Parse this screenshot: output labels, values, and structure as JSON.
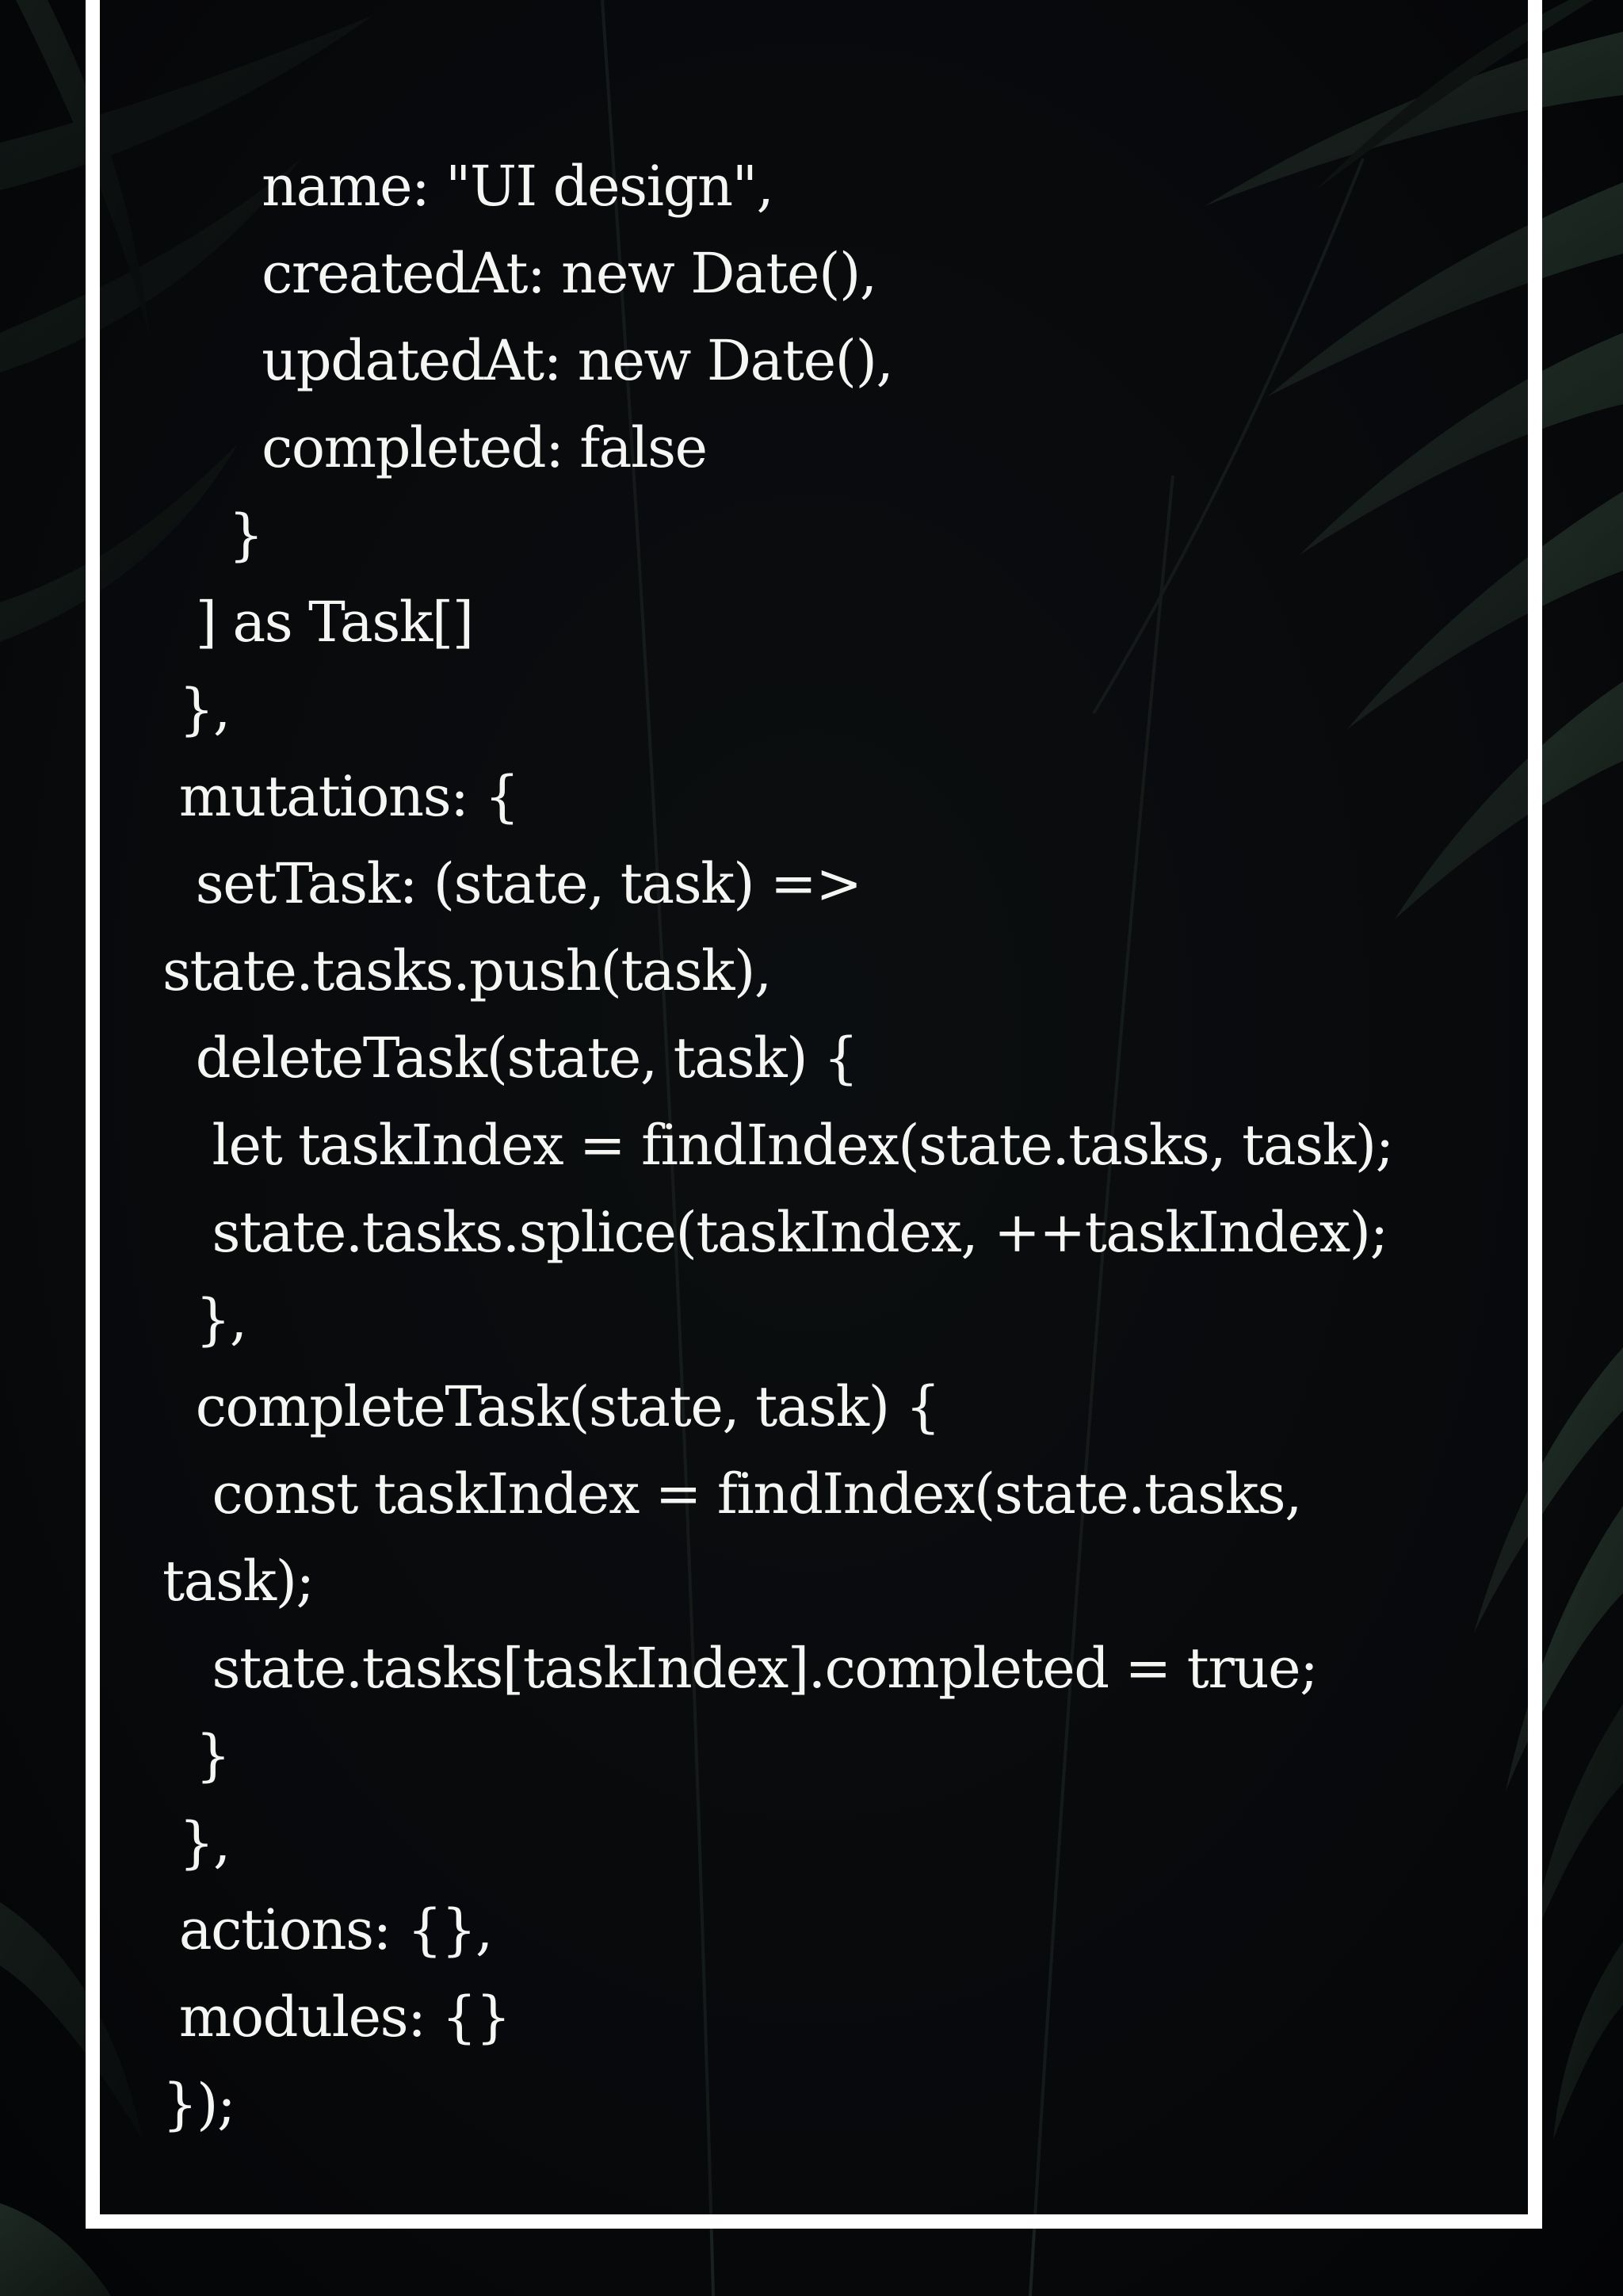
{
  "theme": {
    "text_color": "#f5f5f3",
    "frame_color": "#ffffff",
    "background_color": "#07090b",
    "foliage_color": "#2a3b30"
  },
  "code_lines": [
    {
      "text": "      name: \"UI design\","
    },
    {
      "text": "      createdAt: new Date(),"
    },
    {
      "text": "      updatedAt: new Date(),"
    },
    {
      "text": "      completed: false"
    },
    {
      "text": "    }"
    },
    {
      "text": "  ] as Task[]"
    },
    {
      "text": " },"
    },
    {
      "text": " mutations: {"
    },
    {
      "text": "  setTask: (state, task) =>"
    },
    {
      "text": "state.tasks.push(task),"
    },
    {
      "text": "  deleteTask(state, task) {"
    },
    {
      "text": "   let taskIndex = findIndex(state.tasks, task);"
    },
    {
      "text": "   state.tasks.splice(taskIndex, ++taskIndex);"
    },
    {
      "text": "  },"
    },
    {
      "text": "  completeTask(state, task) {"
    },
    {
      "text": "   const taskIndex = findIndex(state.tasks,"
    },
    {
      "text": "task);"
    },
    {
      "text": "   state.tasks[taskIndex].completed = true;"
    },
    {
      "text": "  }"
    },
    {
      "text": " },"
    },
    {
      "text": " actions: {},"
    },
    {
      "text": " modules: {}"
    },
    {
      "text": "});"
    }
  ]
}
